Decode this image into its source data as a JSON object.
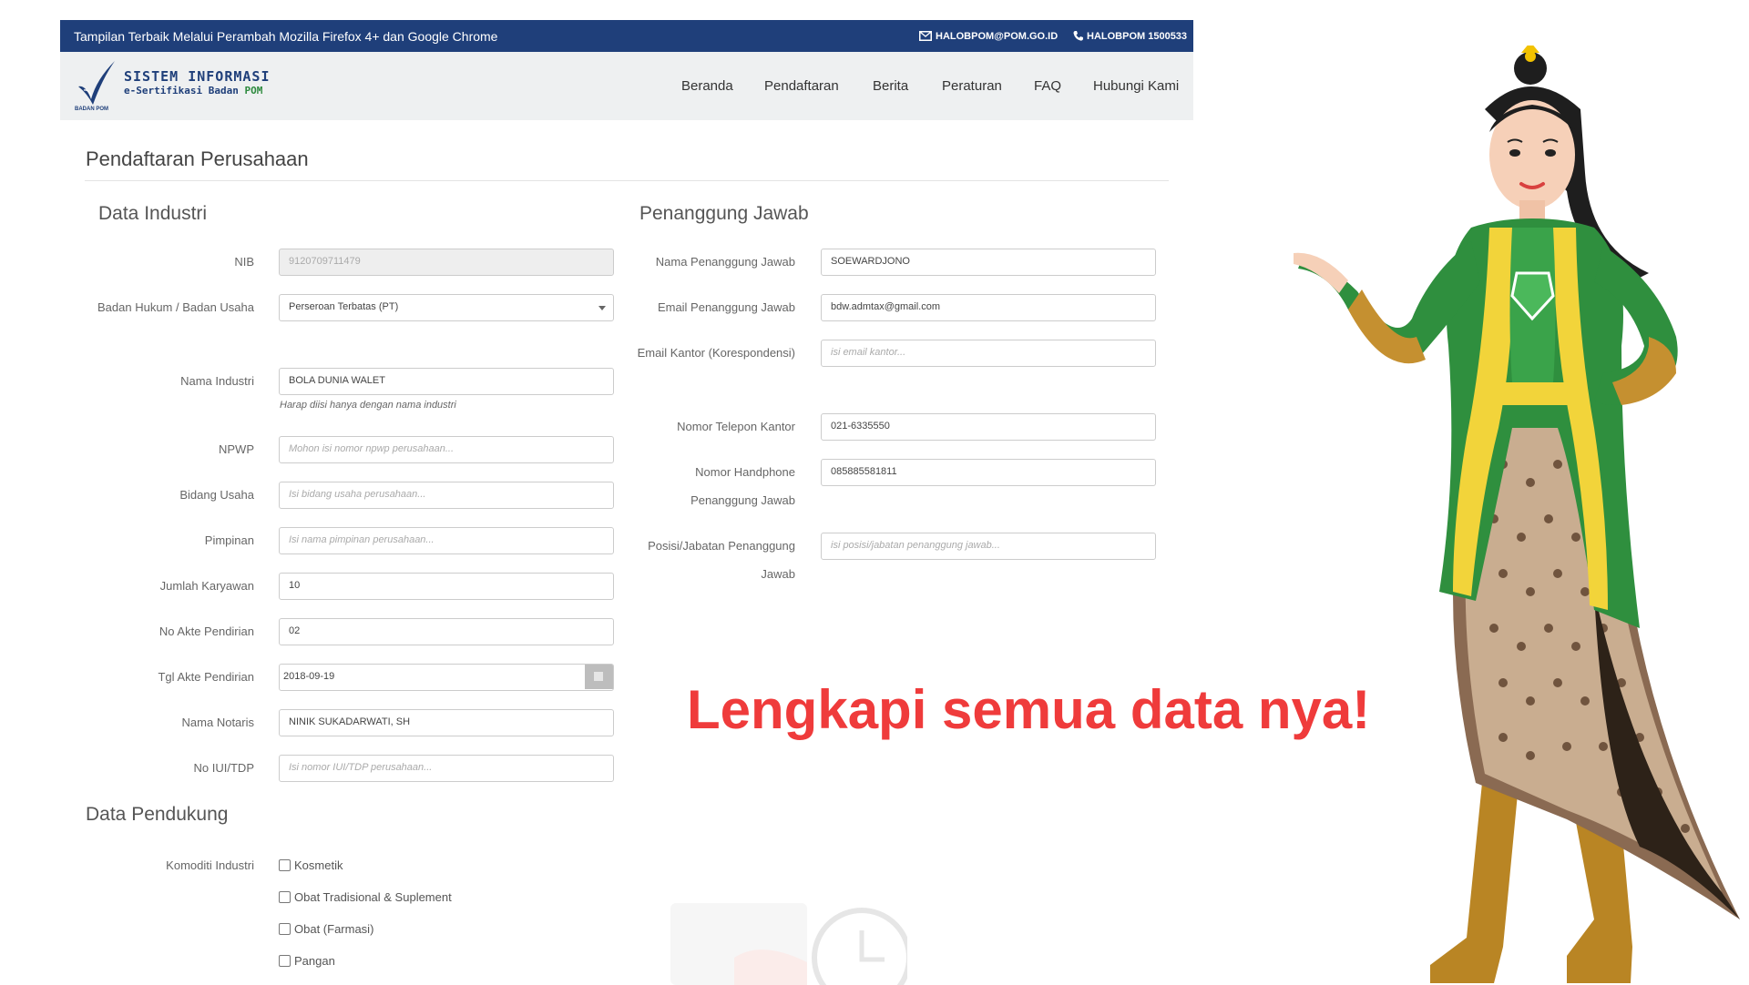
{
  "topbar": {
    "message": "Tampilan Terbaik Melalui Perambah Mozilla Firefox 4+ dan Google Chrome",
    "email": "HALOBPOM@POM.GO.ID",
    "phone": "HALOBPOM 1500533"
  },
  "logo": {
    "line1": "SISTEM INFORMASI",
    "line2_prefix": "e-Sertifikasi Badan",
    "line2_accent": "POM",
    "small": "BADAN POM"
  },
  "nav": [
    "Beranda",
    "Pendaftaran",
    "Berita",
    "Peraturan",
    "FAQ",
    "Hubungi Kami"
  ],
  "page_title": "Pendaftaran Perusahaan",
  "industri": {
    "title": "Data Industri",
    "fields": [
      {
        "label": "NIB",
        "value": "9120709711479"
      },
      {
        "label": "Badan Hukum / Badan Usaha",
        "value": "Perseroan Terbatas (PT)"
      },
      {
        "label": "Nama Industri",
        "value": "BOLA DUNIA WALET",
        "help": "Harap diisi hanya dengan nama industri"
      },
      {
        "label": "NPWP",
        "placeholder": "Mohon isi nomor npwp perusahaan..."
      },
      {
        "label": "Bidang Usaha",
        "placeholder": "Isi bidang usaha perusahaan..."
      },
      {
        "label": "Pimpinan",
        "placeholder": "Isi nama pimpinan perusahaan..."
      },
      {
        "label": "Jumlah Karyawan",
        "value": "10"
      },
      {
        "label": "No Akte Pendirian",
        "value": "02"
      },
      {
        "label": "Tgl Akte Pendirian",
        "value": "2018-09-19"
      },
      {
        "label": "Nama Notaris",
        "value": "NINIK SUKADARWATI, SH"
      },
      {
        "label": "No IUI/TDP",
        "placeholder": "Isi nomor IUI/TDP perusahaan..."
      }
    ]
  },
  "penanggung": {
    "title": "Penanggung Jawab",
    "fields": [
      {
        "label": "Nama Penanggung Jawab",
        "value": "SOEWARDJONO"
      },
      {
        "label": "Email Penanggung Jawab",
        "value": "bdw.admtax@gmail.com"
      },
      {
        "label": "Email Kantor (Korespondensi)",
        "placeholder": "isi email kantor..."
      },
      {
        "label": "Nomor Telepon Kantor",
        "value": "021-6335550"
      },
      {
        "label": "Nomor Handphone Penanggung Jawab",
        "value": "085885581811"
      },
      {
        "label": "Posisi/Jabatan Penanggung Jawab",
        "placeholder": "isi posisi/jabatan penanggung jawab..."
      }
    ]
  },
  "pendukung": {
    "title": "Data Pendukung",
    "komoditi_label": "Komoditi Industri",
    "options": [
      "Kosmetik",
      "Obat Tradisional & Suplement",
      "Obat (Farmasi)",
      "Pangan"
    ]
  },
  "callout": "Lengkapi semua data nya!",
  "colors": {
    "topbar": "#1f3f7a",
    "navbar": "#eef0f1",
    "callout": "#ef3b3b",
    "kebaya_green": "#2f8f3e",
    "kebaya_yellow": "#f2d43a"
  }
}
